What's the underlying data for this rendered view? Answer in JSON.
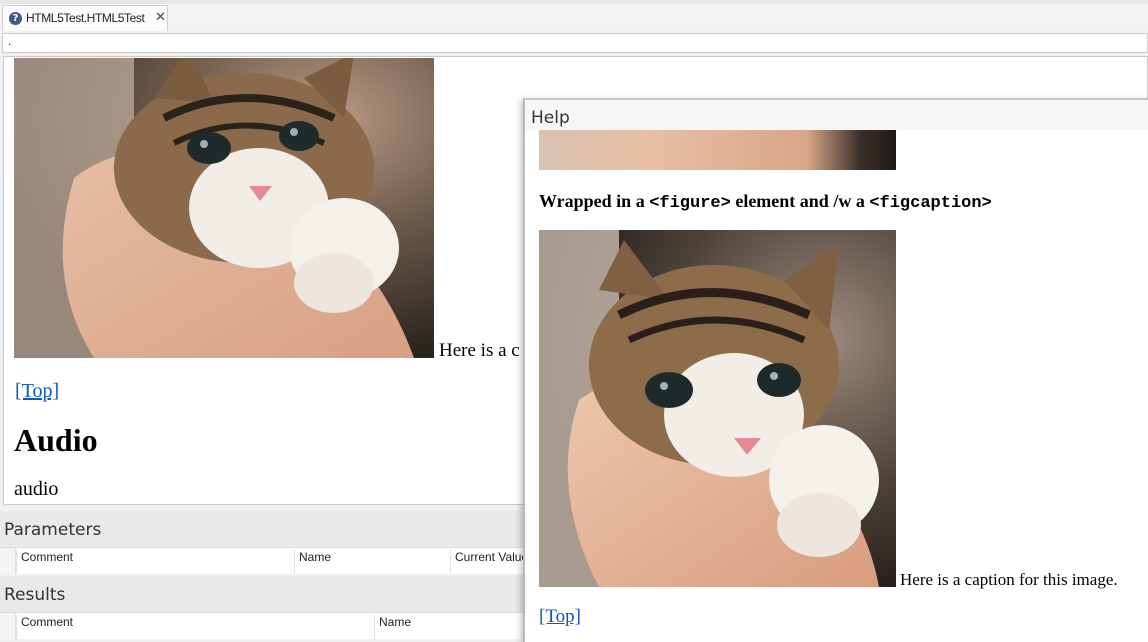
{
  "tab": {
    "title": "HTML5Test.HTML5Test",
    "close": "✕",
    "icon": "help-icon"
  },
  "address": {
    "value": "."
  },
  "page": {
    "image_caption": "Here is a c",
    "top_link": "[Top]",
    "audio_heading": "Audio",
    "audio_text": "audio"
  },
  "parameters": {
    "title": "Parameters",
    "columns": [
      "Comment",
      "Name",
      "Current Value"
    ]
  },
  "results": {
    "title": "Results",
    "columns": [
      "Comment",
      "Name"
    ]
  },
  "help": {
    "title": "Help",
    "heading_pre": "Wrapped in a ",
    "heading_code1": "<figure>",
    "heading_mid": " element and /w a ",
    "heading_code2": "<figcaption>",
    "caption": "Here is a caption for this image.",
    "top_link": "[Top]"
  },
  "colors": {
    "link": "#0b57c2",
    "tab_icon": "#3a5a8c"
  }
}
